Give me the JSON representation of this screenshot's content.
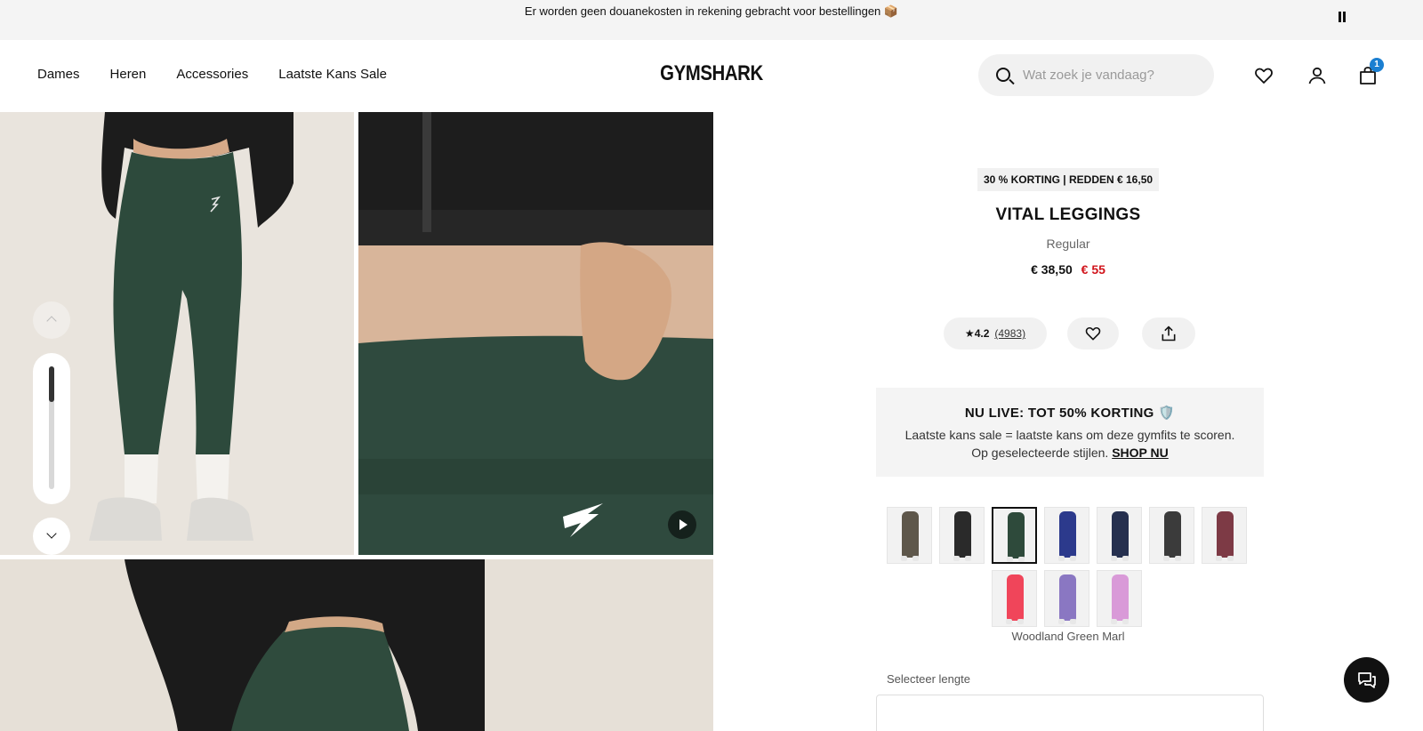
{
  "announcement": {
    "text": "Er worden geen douanekosten in rekening gebracht voor bestellingen 📦"
  },
  "header": {
    "nav": [
      "Dames",
      "Heren",
      "Accessories",
      "Laatste Kans Sale"
    ],
    "logo": "GYMSHARK",
    "search_placeholder": "Wat zoek je vandaag?",
    "cart_count": "1",
    "badge_color": "#1b7fd1"
  },
  "product": {
    "discount_badge": "30 % KORTING | REDDEN € 16,50",
    "title": "VITAL LEGGINGS",
    "fit": "Regular",
    "price_now": "€ 38,50",
    "price_old": "€ 55",
    "sale_color": "#d1141b",
    "rating": "4.2",
    "review_count": "(4983)"
  },
  "promo": {
    "title": "NU LIVE: TOT 50% KORTING 🛡️",
    "body": "Laatste kans sale = laatste kans om deze gymfits te scoren. Op geselecteerde stijlen.",
    "link": "SHOP NU"
  },
  "swatches": [
    {
      "color": "#5e574b",
      "selected": false
    },
    {
      "color": "#2a2a2a",
      "selected": false
    },
    {
      "color": "#2e4a3b",
      "selected": true
    },
    {
      "color": "#2c3a8c",
      "selected": false
    },
    {
      "color": "#26304f",
      "selected": false
    },
    {
      "color": "#3b3b3b",
      "selected": false
    },
    {
      "color": "#7d3a45",
      "selected": false
    },
    {
      "color": "#f0455a",
      "selected": false
    },
    {
      "color": "#8a77c2",
      "selected": false
    },
    {
      "color": "#d99ad8",
      "selected": false
    }
  ],
  "selected_colour_name": "Woodland Green Marl",
  "length_label": "Selecteer lengte"
}
